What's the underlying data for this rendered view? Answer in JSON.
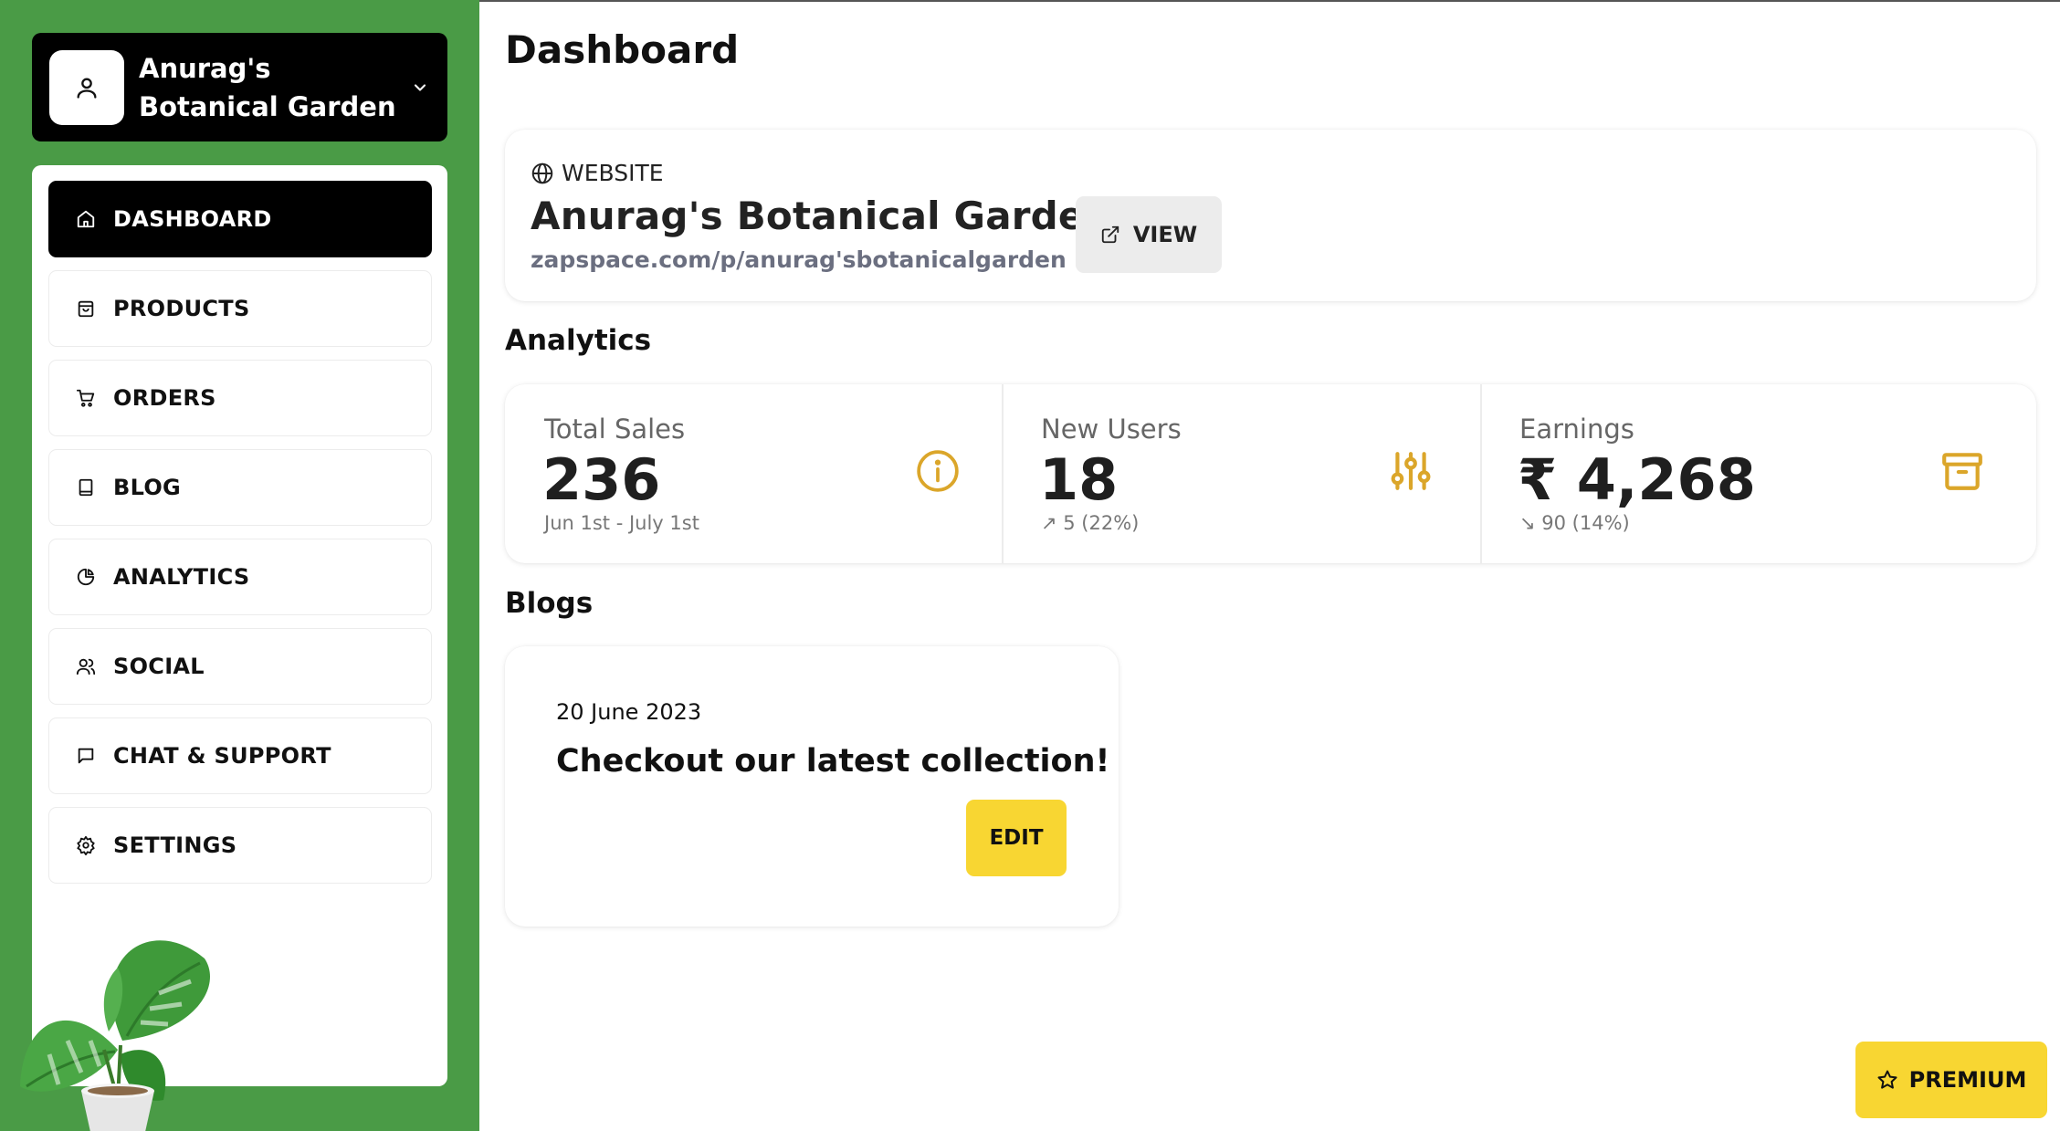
{
  "account": {
    "name": "Anurag's Botanical Garden",
    "avatar_icon": "user-icon",
    "menu_icon": "chevron-down-icon"
  },
  "sidebar": {
    "items": [
      {
        "label": "DASHBOARD",
        "icon": "home-icon",
        "active": true
      },
      {
        "label": "PRODUCTS",
        "icon": "shopping-bag-icon",
        "active": false
      },
      {
        "label": "ORDERS",
        "icon": "cart-icon",
        "active": false
      },
      {
        "label": "BLOG",
        "icon": "book-icon",
        "active": false
      },
      {
        "label": "ANALYTICS",
        "icon": "pie-chart-icon",
        "active": false
      },
      {
        "label": "SOCIAL",
        "icon": "users-icon",
        "active": false
      },
      {
        "label": "CHAT & SUPPORT",
        "icon": "message-icon",
        "active": false
      },
      {
        "label": "SETTINGS",
        "icon": "gear-icon",
        "active": false
      }
    ]
  },
  "page": {
    "title": "Dashboard"
  },
  "website": {
    "label": "WEBSITE",
    "name": "Anurag's Botanical Garden",
    "url": "zapspace.com/p/anurag'sbotanicalgarden",
    "view_label": "VIEW"
  },
  "analytics": {
    "title": "Analytics",
    "stats": [
      {
        "label": "Total Sales",
        "value": "236",
        "sub": "Jun 1st - July 1st",
        "icon": "info-icon"
      },
      {
        "label": "New Users",
        "value": "18",
        "sub": "↗ 5 (22%)",
        "icon": "sliders-icon"
      },
      {
        "label": "Earnings",
        "value": "₹ 4,268",
        "sub": "↘ 90 (14%)",
        "icon": "archive-icon"
      }
    ]
  },
  "blogs": {
    "title": "Blogs",
    "items": [
      {
        "date": "20 June 2023",
        "title": "Checkout our latest collection!",
        "edit_label": "EDIT"
      }
    ]
  },
  "premium": {
    "label": "PREMIUM",
    "icon": "star-icon"
  },
  "colors": {
    "sidebar_green": "#4a9b46",
    "accent_yellow": "#f8d632",
    "icon_gold": "#dba62a",
    "black": "#000000"
  }
}
